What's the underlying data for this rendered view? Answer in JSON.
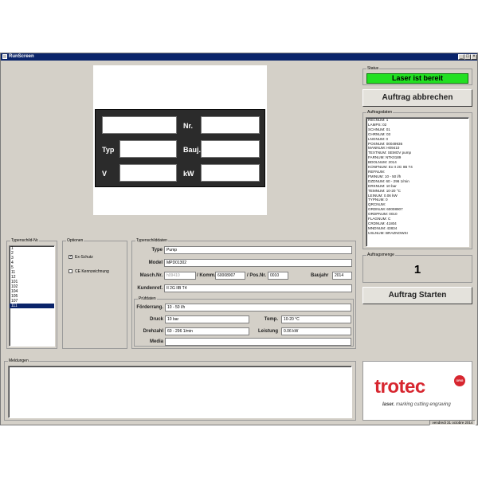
{
  "window": {
    "title": "RunScreen",
    "controls": [
      "_",
      "□",
      "×"
    ]
  },
  "plate": {
    "labels": {
      "nr": "Nr.",
      "typ": "Typ",
      "bauj": "Bauj.",
      "v": "V",
      "kw": "kW"
    }
  },
  "status": {
    "group_label": "Status",
    "text": "Laser ist bereit",
    "color": "#22e022"
  },
  "buttons": {
    "abort": "Auftrag abbrechen",
    "start": "Auftrag Starten"
  },
  "order_data": {
    "group_label": "Auftragsdaten",
    "lines": [
      "RECNUM: 1",
      "LAMPS: 02",
      "SCHNUM: 01",
      "CHRNUM: 03",
      "LNGNUM: 0",
      "POSNUM: 00049936",
      "MANNUM: H09410",
      "TEXTNUM: SEMOV pump",
      "FARNUM: NTK0189",
      "BDOLNUM: 2014",
      "KONFNUM: Ex II 2G IIB T4",
      "REFNUM:",
      "FMINUM: 10 - 50 l/h",
      "DZDNUM: 60 - 296 1/min",
      "DRKNUM: 10 bar",
      "TEMNUM: 10-20 °C",
      "LEINUM: 0.06 kW",
      "TYPNUM: 0",
      "QRCNUM:",
      "ORDNUM: 60008907",
      "ORDPNUM: 0010",
      "FLAGNUM: C",
      "CRDNUM: 41804",
      "MNDNUM: 43834",
      "USLNUM: BRAZNOWSI"
    ]
  },
  "order_qty": {
    "group_label": "Auftragsmenge",
    "value": "1"
  },
  "type_list": {
    "group_label": "Typenschild-Nr.",
    "items": [
      "1",
      "2",
      "3",
      "4",
      "5",
      "11",
      "12",
      "101",
      "102",
      "104",
      "105",
      "107",
      "111"
    ],
    "selected_index": 12
  },
  "options": {
    "group_label": "Optionen",
    "ex_label": "Ex-Schutz",
    "ex_checked": "✓",
    "ce_label": "CE Kennzeichnung",
    "ce_checked": ""
  },
  "plate_data": {
    "group_label": "Typenschilddaten",
    "type_label": "Type",
    "type_value": "Pump",
    "model_label": "Model",
    "model_value": "MPD01302",
    "maschnr_label": "Masch.Nr.",
    "maschnr_value": "h09410",
    "komm_label": "/ Komm.",
    "komm_value": "60008907",
    "posnr_label": "/ Pos.Nr.",
    "posnr_value": "0010",
    "baujahr_label": "Baujahr",
    "baujahr_value": "2014",
    "kundenref_label": "Kundenref.",
    "kundenref_value": "II 2G IIB T4"
  },
  "test_data": {
    "group_label": "Prüfdaten",
    "foerder_label": "Förderrang.",
    "foerder_value": "10 - 50 l/h",
    "druck_label": "Druck",
    "druck_value": "10 bar",
    "temp_label": "Temp.",
    "temp_value": "10-20 °C",
    "drehzahl_label": "Drehzahl",
    "drehzahl_value": "60 - 296 1/min",
    "leistung_label": "Leistung",
    "leistung_value": "0.06 kW",
    "media_label": "Media",
    "media_value": ""
  },
  "messages": {
    "group_label": "Meldungen"
  },
  "logo": {
    "brand": "trotec",
    "tagline_bold": "laser.",
    "tagline": " marking cutting engraving",
    "badge": "ORIG",
    "color": "#d7262f"
  },
  "statusbar": {
    "date": "vendredi 31 octobre 2014"
  }
}
